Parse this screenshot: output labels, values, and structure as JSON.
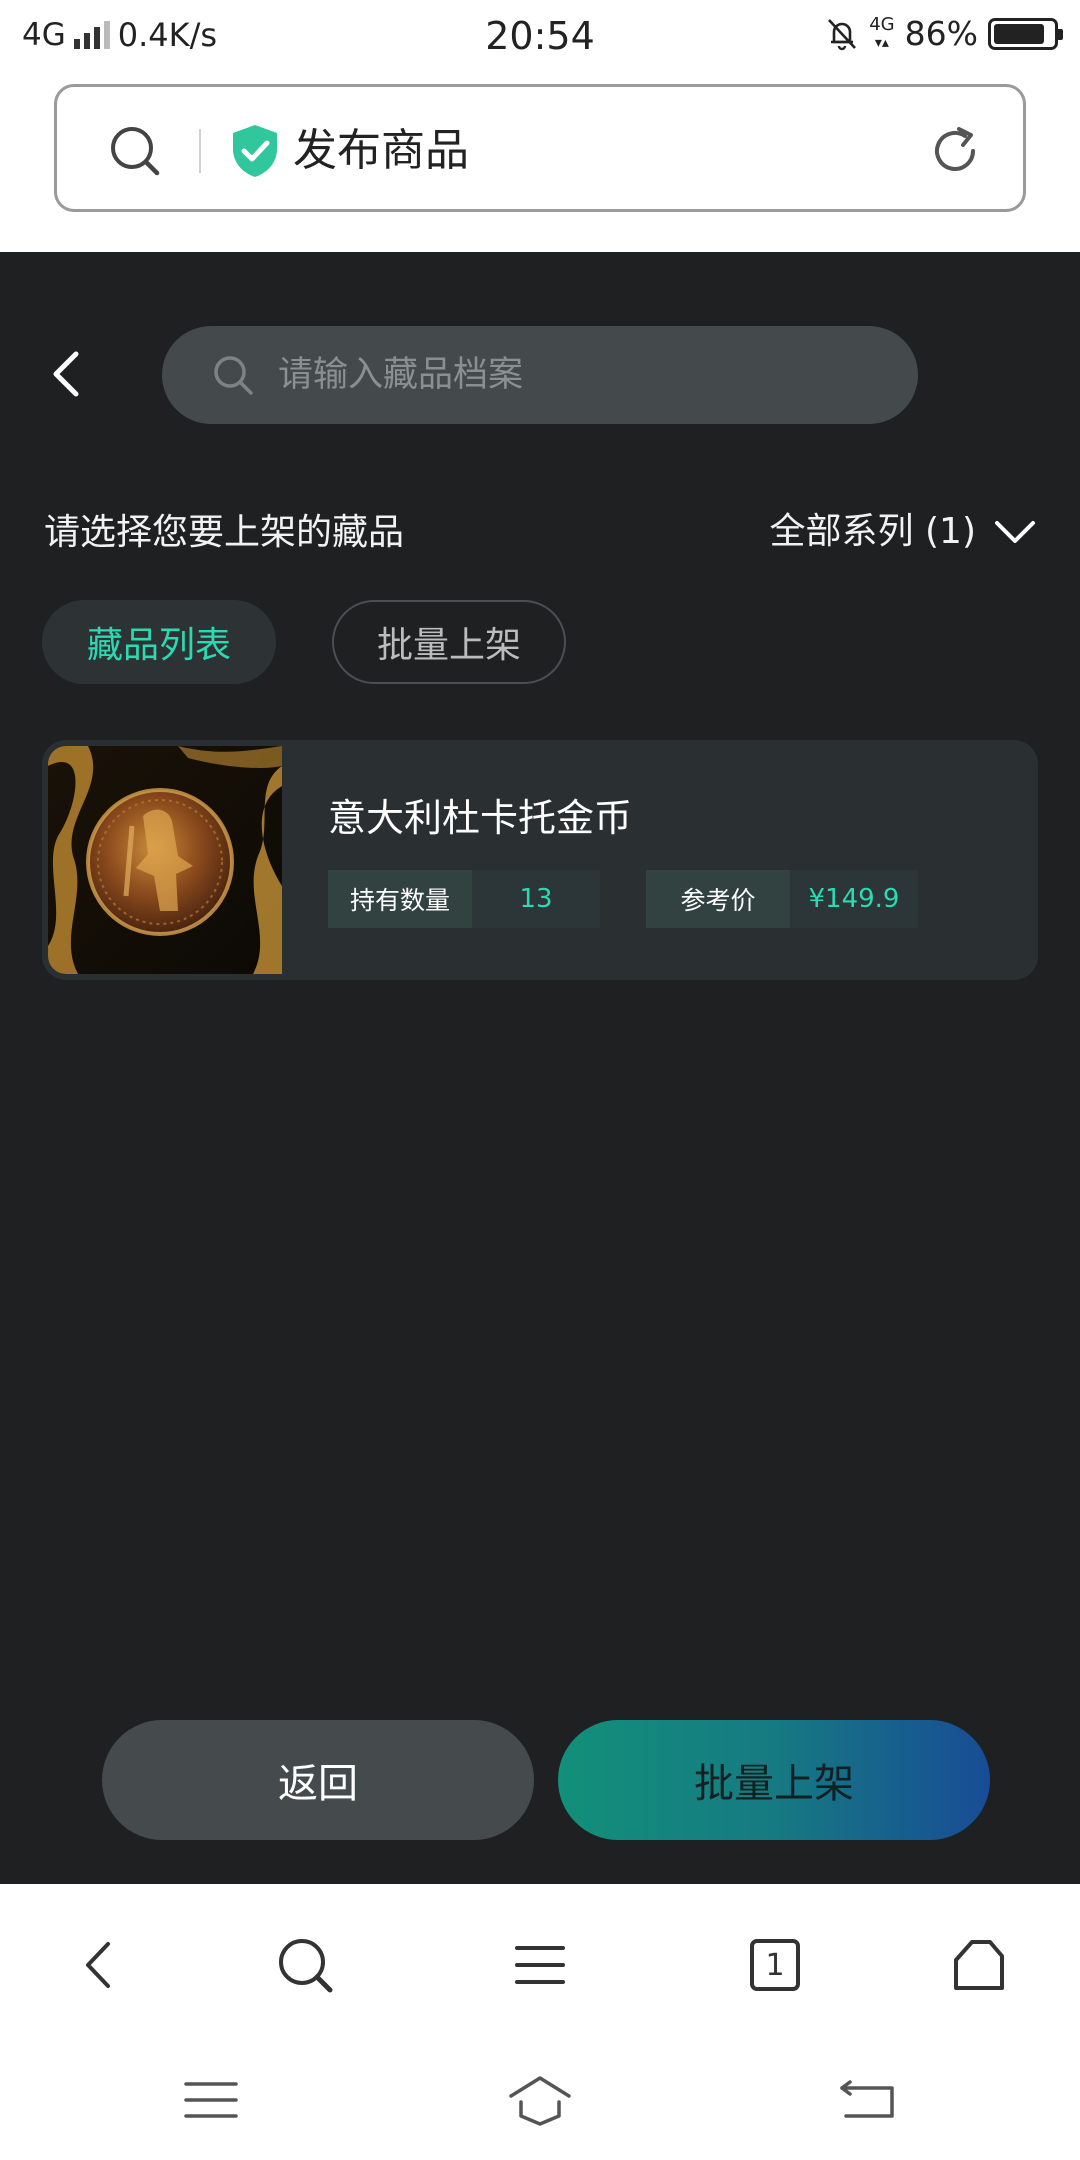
{
  "status_bar": {
    "network": "4G",
    "speed": "0.4K/s",
    "time": "20:54",
    "network_right": "4G",
    "battery_percent": "86%",
    "battery_level": 0.86
  },
  "browser": {
    "page_title": "发布商品",
    "secure_color": "#2fc79b",
    "tabs_count": "1"
  },
  "header": {
    "search_placeholder": "请输入藏品档案"
  },
  "selector": {
    "prompt": "请选择您要上架的藏品",
    "series_label": "全部系列 (1)"
  },
  "tabs": {
    "list_label": "藏品列表",
    "batch_label": "批量上架"
  },
  "items": [
    {
      "title": "意大利杜卡托金币",
      "qty_label": "持有数量",
      "qty_value": "13",
      "price_label": "参考价",
      "price_value": "¥149.9"
    }
  ],
  "actions": {
    "back_label": "返回",
    "batch_label": "批量上架"
  },
  "colors": {
    "accent": "#2dd9b1",
    "background": "#1e2022",
    "card": "#2a3032"
  }
}
